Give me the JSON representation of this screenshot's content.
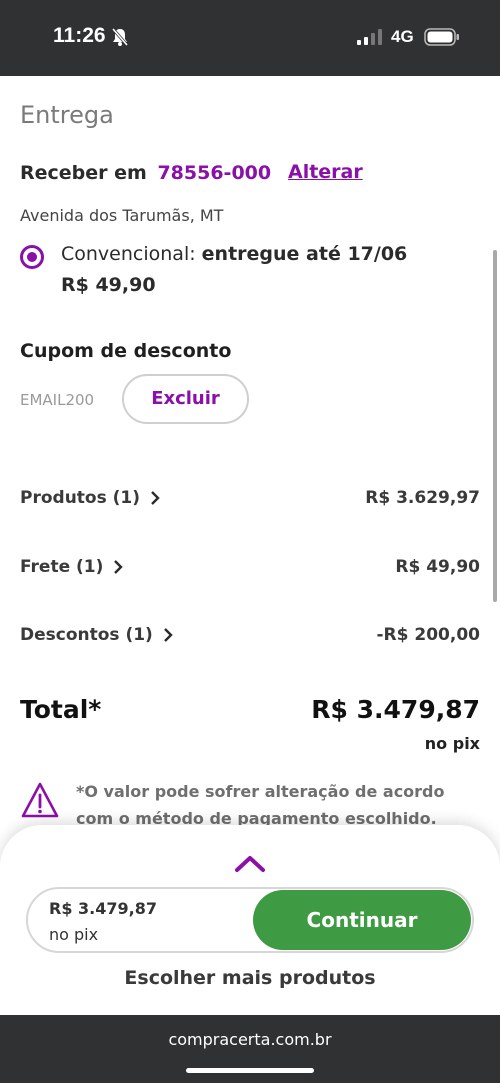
{
  "status_bar": {
    "time": "11:26",
    "network": "4G",
    "icons": [
      "bell-slash-icon",
      "signal-icon",
      "battery-icon"
    ]
  },
  "delivery": {
    "section_title": "Entrega",
    "receive_label": "Receber em",
    "cep": "78556-000",
    "change_link": "Alterar",
    "address": "Avenida dos Tarumãs, MT",
    "option_type": "Convencional:",
    "option_eta": "entregue até 17/06",
    "option_price": "R$ 49,90"
  },
  "coupon": {
    "title": "Cupom de desconto",
    "code": "EMAIL200",
    "remove_label": "Excluir"
  },
  "summary": {
    "products": {
      "label": "Produtos (1)",
      "value": "R$ 3.629,97"
    },
    "shipping": {
      "label": "Frete (1)",
      "value": "R$ 49,90"
    },
    "discounts": {
      "label": "Descontos (1)",
      "value": "-R$ 200,00"
    },
    "total_label": "Total*",
    "total_value": "R$ 3.479,87",
    "total_note": "no pix"
  },
  "notice": {
    "text": "*O valor pode sofrer alteração de acordo com o método de pagamento escolhido."
  },
  "checkout_bar": {
    "price": "R$ 3.479,87",
    "price_note": "no pix",
    "continue_label": "Continuar",
    "more_products_label": "Escolher mais produtos"
  },
  "browser": {
    "url": "compracerta.com.br"
  },
  "colors": {
    "brand_purple": "#8a10a8",
    "continue_green": "#3f9a44",
    "bar_dark": "#303132"
  }
}
